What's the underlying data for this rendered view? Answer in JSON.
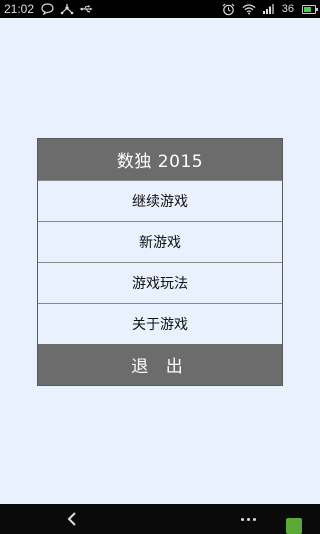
{
  "status_bar": {
    "time": "21:02",
    "signal_text": "36",
    "icons": [
      "chat-icon",
      "usb-share-icon",
      "usb-icon",
      "alarm-icon",
      "wifi-icon",
      "signal-icon",
      "battery-icon"
    ]
  },
  "menu": {
    "title": "数独 2015",
    "items": [
      {
        "label": "继续游戏"
      },
      {
        "label": "新游戏"
      },
      {
        "label": "游戏玩法"
      },
      {
        "label": "关于游戏"
      }
    ],
    "exit_label": "退 出"
  },
  "nav_bar": {
    "icons": [
      "back-icon",
      "more-icon"
    ]
  },
  "colors": {
    "background": "#e8f1fd",
    "header": "#6c6c6c",
    "status_bar": "#000000"
  }
}
